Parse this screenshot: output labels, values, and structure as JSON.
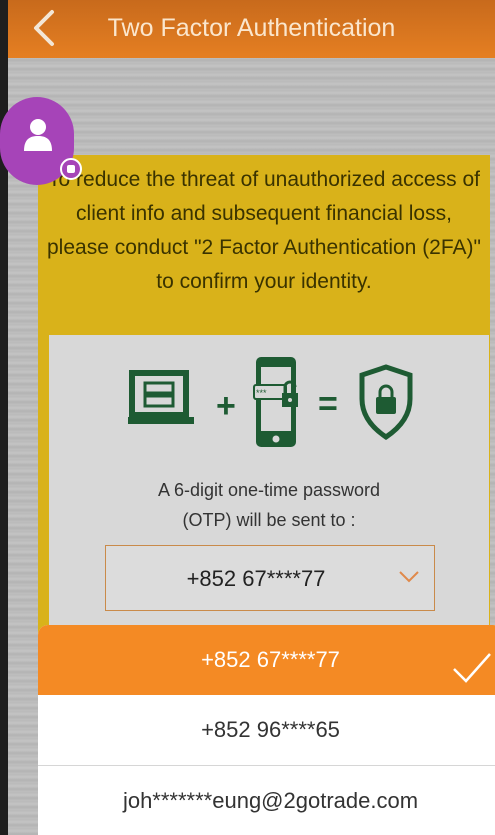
{
  "header": {
    "title": "Two Factor Authentication",
    "back_icon": "chevron-left-icon"
  },
  "notice": {
    "text": "To reduce the threat of unauthorized access of client info and subsequent financial loss, please conduct \"2 Factor Authentication (2FA)\" to confirm your identity."
  },
  "illustration": {
    "plus": "+",
    "equals": "=",
    "icons": [
      "laptop-icon",
      "phone-lock-icon",
      "shield-lock-icon"
    ]
  },
  "otp": {
    "line1": "A 6-digit one-time password",
    "line2": "(OTP) will be sent to :",
    "selected": "+852 67****77"
  },
  "options": [
    {
      "label": "+852 67****77",
      "selected": true
    },
    {
      "label": "+852 96****65",
      "selected": false
    },
    {
      "label": "joh*******eung@2gotrade.com",
      "selected": false
    }
  ],
  "colors": {
    "header": "#e57f22",
    "card": "#d9b21a",
    "accent": "#f48a24",
    "icon_green": "#1e5b33",
    "avatar": "#a644b8"
  }
}
